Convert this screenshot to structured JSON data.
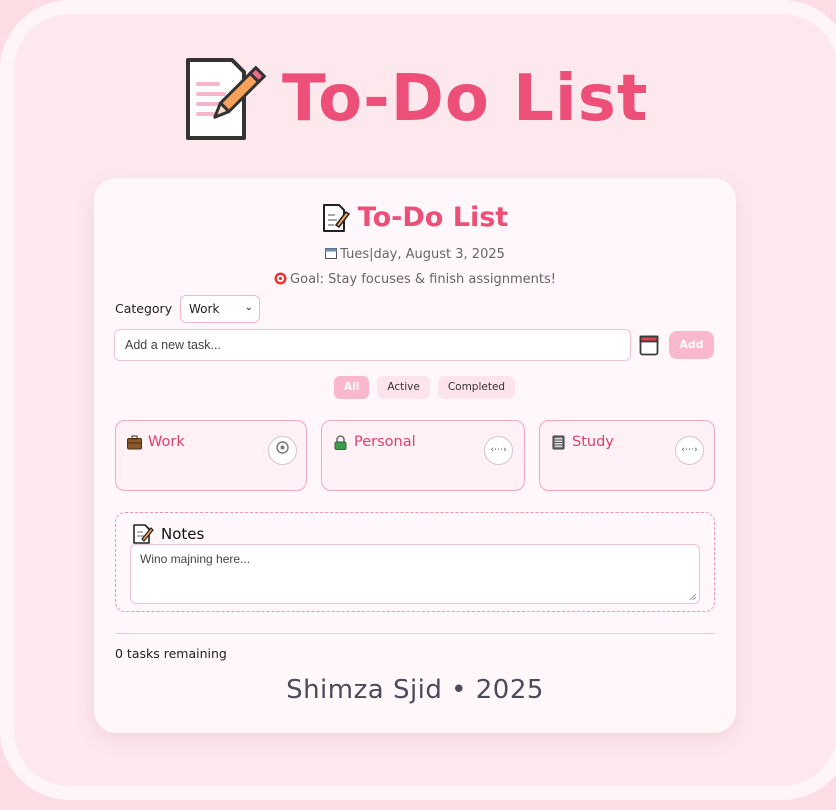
{
  "header": {
    "title": "To-Do List"
  },
  "card": {
    "title": "To-Do List",
    "date": "Tues|day, August 3, 2025",
    "goal": "Goal: Stay focuses & finish assignments!"
  },
  "category": {
    "label": "Category",
    "selected": "Work"
  },
  "task_input": {
    "placeholder": "Add a new task..."
  },
  "add_button": "Add",
  "filters": [
    {
      "label": "All",
      "active": true
    },
    {
      "label": "Active",
      "active": false
    },
    {
      "label": "Completed",
      "active": false
    }
  ],
  "categories": [
    {
      "label": "Work",
      "icon": "briefcase-icon",
      "action": "palette-icon"
    },
    {
      "label": "Personal",
      "icon": "lock-icon",
      "action": "code-icon"
    },
    {
      "label": "Study",
      "icon": "notebook-icon",
      "action": "code-icon"
    }
  ],
  "notes": {
    "title": "Notes",
    "placeholder": "Wino majning here..."
  },
  "status": {
    "remaining": "0 tasks remaining"
  },
  "footer": "Shimza Sjid • 2025",
  "colors": {
    "accent": "#ec4f78",
    "page_bg": "#fde8ee",
    "button": "#f9b8cb"
  }
}
